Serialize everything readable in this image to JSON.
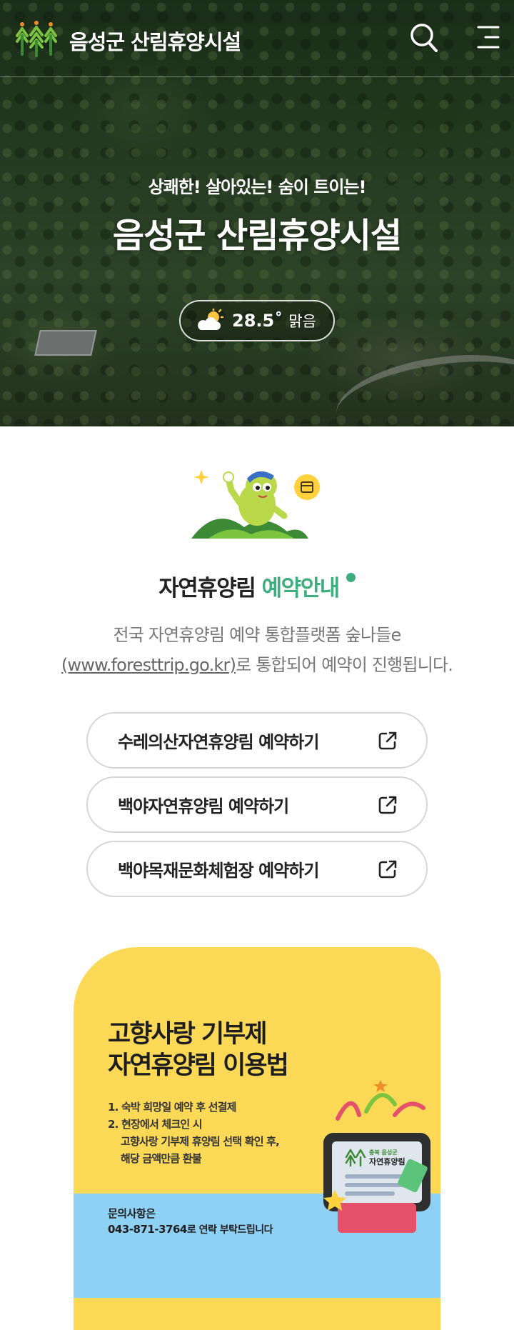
{
  "header": {
    "site_title": "음성군 산림휴양시설",
    "logo_icon": "forest-logo-icon",
    "search_icon": "search-icon",
    "menu_icon": "hamburger-menu-icon"
  },
  "hero": {
    "subtitle": "상쾌한! 살아있는! 숨이 트이는!",
    "title": "음성군 산림휴양시설",
    "weather": {
      "icon": "sun-cloud-icon",
      "temperature": "28.5˚",
      "condition": "맑음"
    }
  },
  "reservation": {
    "title_main": "자연휴양림 ",
    "title_accent": "예약안내",
    "desc_line1": "전국 자연휴양림 예약 통합플랫폼 숲나들e",
    "desc_link": "(www.foresttrip.go.kr)",
    "desc_line2_rest": "로 통합되어 예약이 진행됩니다.",
    "buttons": [
      {
        "label": "수레의산자연휴양림 예약하기",
        "icon": "external-link-icon"
      },
      {
        "label": "백야자연휴양림 예약하기",
        "icon": "external-link-icon"
      },
      {
        "label": "백야목재문화체험장 예약하기",
        "icon": "external-link-icon"
      }
    ]
  },
  "banner": {
    "title_line1": "고향사랑 기부제",
    "title_line2": "자연휴양림 이용법",
    "step1": "1. 숙박 희망일 예약 후 선결제",
    "step2": "2. 현장에서 체크인 시",
    "step2_detail1": "고향사랑 기부제 휴양림 선택 확인 후,",
    "step2_detail2": "해당 금액만큼 환불",
    "contact_label": "문의사항은",
    "contact_phone": "043-871-3764",
    "contact_suffix": "로 연락 부탁드립니다",
    "kiosk_label_small": "충북 음성군",
    "kiosk_label": "자연휴양림",
    "colors": {
      "yellow": "#fbd957",
      "blue": "#8fd0f5",
      "kiosk": "#e5506b"
    }
  },
  "colors": {
    "accent_green": "#3fae7f",
    "button_border": "#d6d6d6"
  }
}
